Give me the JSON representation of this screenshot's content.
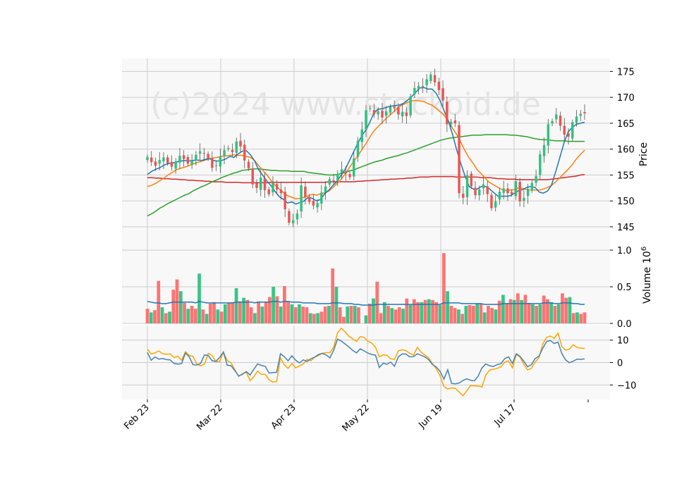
{
  "watermark": "(c)2024 www.stockoid.de",
  "chart_data": {
    "type": "candlestick",
    "title": "",
    "x_tick_labels": [
      "Feb 23",
      "Mar 22",
      "Apr 23",
      "May 22",
      "Jun 19",
      "Jul 17"
    ],
    "colors": {
      "up": "#26a69a",
      "up_fill": "#2ec27e",
      "down": "#ef5350",
      "ma_short": "#1f77b4",
      "ma_mid": "#ff7f0e",
      "ma_long": "#2ca02c",
      "ma_200": "#d62728",
      "vol_avg": "#1f77b4",
      "osc_1": "#4682b4",
      "osc_2": "#ffa500",
      "panel_bg": "#f8f8f8",
      "grid": "#cccccc"
    },
    "price_panel": {
      "ylabel": "Price",
      "ylim": [
        140.5,
        177.5
      ],
      "yticks": [
        145,
        150,
        155,
        160,
        165,
        170,
        175
      ],
      "closes": [
        158.5,
        157.5,
        156.8,
        157.9,
        158.4,
        157.3,
        156.6,
        157.5,
        158.7,
        158.1,
        157.2,
        157.8,
        158.9,
        159.6,
        159.2,
        158.2,
        156.4,
        156.9,
        158.6,
        159.8,
        160.2,
        159.4,
        161.5,
        160.5,
        157.8,
        156.3,
        153.2,
        152.5,
        154.5,
        152.1,
        151.3,
        153.5,
        152.2,
        151.5,
        148.4,
        145.8,
        146.3,
        147.6,
        153.0,
        150.8,
        149.8,
        149.1,
        149.6,
        151.6,
        152.8,
        154.2,
        153.9,
        155.2,
        156.1,
        155.3,
        154.6,
        158.2,
        161.6,
        163.8,
        167.5,
        167.9,
        166.8,
        167.3,
        166.1,
        167.3,
        168.2,
        167.9,
        166.7,
        167.2,
        166.4,
        170.2,
        171.8,
        172.2,
        172.1,
        173.5,
        174.4,
        172.9,
        171.4,
        169.4,
        164.8,
        165.3,
        165.0,
        151.5,
        150.6,
        154.9,
        152.8,
        151.1,
        152.2,
        153.2,
        151.3,
        148.6,
        149.9,
        151.8,
        152.4,
        151.5,
        151.3,
        153.8,
        149.9,
        150.6,
        152.3,
        153.5,
        154.8,
        159.0,
        160.8,
        164.8,
        165.4,
        166.7,
        164.5,
        162.8,
        162.4,
        165.2,
        166.3,
        166.8,
        166.9
      ],
      "ma_short": [
        155.1,
        155.7,
        156.1,
        156.4,
        156.9,
        157.2,
        157.3,
        157.5,
        157.7,
        157.8,
        157.7,
        157.8,
        157.9,
        157.8,
        158.0,
        158.2,
        157.8,
        157.7,
        157.8,
        158.1,
        158.6,
        158.4,
        159.1,
        159.6,
        159.7,
        158.9,
        157.7,
        156.0,
        154.9,
        153.8,
        152.9,
        151.8,
        150.8,
        150.3,
        149.6,
        149.8,
        149.4,
        149.7,
        150.0,
        150.7,
        150.5,
        150.0,
        150.3,
        151.4,
        152.1,
        153.0,
        153.8,
        155.0,
        156.2,
        157.8,
        159.5,
        161.1,
        162.6,
        163.7,
        165.3,
        167.1,
        167.7,
        167.8,
        168.1,
        168.3,
        168.4,
        168.5,
        168.8,
        169.4,
        170.1,
        170.9,
        171.8,
        171.9,
        171.6,
        171.6,
        170.8,
        169.3,
        167.3,
        165.4,
        162.8,
        159.8,
        157.2,
        154.8,
        152.8,
        152.3,
        152.3,
        152.8,
        152.8,
        152.3,
        151.6,
        150.9,
        150.9,
        150.9,
        151.0,
        151.5,
        152.0,
        152.2,
        152.6,
        152.8,
        152.6,
        151.7,
        151.5,
        151.9,
        153.1,
        155.7,
        158.4,
        161.2,
        163.3,
        164.2,
        164.8,
        165.0,
        165.2
      ],
      "ma_mid": [
        152.8,
        153.0,
        153.4,
        153.9,
        154.4,
        155.0,
        155.5,
        156.0,
        156.3,
        156.5,
        156.8,
        157.1,
        157.4,
        157.6,
        157.9,
        158.1,
        158.3,
        158.4,
        158.6,
        158.7,
        158.8,
        158.9,
        158.8,
        158.8,
        158.6,
        158.4,
        157.8,
        156.8,
        155.9,
        155.0,
        153.9,
        153.0,
        152.3,
        151.6,
        151.0,
        150.7,
        150.4,
        150.5,
        150.7,
        151.0,
        151.3,
        151.1,
        151.4,
        151.6,
        151.9,
        152.6,
        153.4,
        154.2,
        155.3,
        156.5,
        157.6,
        158.7,
        159.9,
        161.1,
        162.4,
        163.6,
        164.4,
        165.2,
        166.0,
        166.7,
        167.4,
        168.2,
        168.6,
        169.0,
        169.3,
        169.4,
        169.3,
        169.2,
        168.8,
        168.5,
        167.9,
        167.2,
        166.5,
        165.3,
        164.0,
        162.8,
        161.3,
        159.7,
        158.3,
        157.2,
        156.0,
        155.2,
        154.3,
        153.5,
        153.1,
        152.6,
        152.2,
        152.0,
        152.1,
        152.2,
        152.5,
        152.4,
        152.2,
        152.1,
        152.1,
        152.1,
        152.3,
        152.6,
        153.0,
        153.7,
        154.5,
        155.3,
        156.1,
        157.0,
        158.1,
        159.0,
        159.8
      ],
      "ma_long": [
        147.1,
        147.5,
        148.0,
        148.6,
        149.0,
        149.5,
        149.9,
        150.3,
        150.7,
        151.1,
        151.4,
        151.9,
        152.3,
        152.7,
        153.0,
        153.4,
        153.8,
        154.1,
        154.5,
        154.8,
        155.1,
        155.4,
        155.6,
        155.9,
        156.0,
        156.1,
        156.2,
        156.2,
        156.1,
        156.0,
        155.9,
        155.9,
        155.8,
        155.8,
        155.8,
        155.7,
        155.7,
        155.7,
        155.7,
        155.5,
        155.4,
        155.3,
        155.2,
        155.1,
        155.0,
        155.0,
        155.1,
        155.3,
        155.5,
        155.8,
        156.0,
        156.3,
        156.6,
        156.9,
        157.2,
        157.5,
        157.7,
        157.9,
        158.2,
        158.4,
        158.6,
        158.8,
        159.1,
        159.3,
        159.6,
        159.9,
        160.2,
        160.5,
        160.8,
        161.1,
        161.4,
        161.7,
        161.9,
        162.1,
        162.2,
        162.3,
        162.4,
        162.5,
        162.6,
        162.7,
        162.7,
        162.7,
        162.8,
        162.8,
        162.8,
        162.8,
        162.8,
        162.8,
        162.7,
        162.7,
        162.6,
        162.5,
        162.4,
        162.2,
        162.0,
        161.9,
        161.8,
        161.8,
        161.7,
        161.6,
        161.6,
        161.6,
        161.5,
        161.5,
        161.5,
        161.5,
        161.5
      ],
      "ma_200": [
        154.5,
        154.5,
        154.4,
        154.4,
        154.3,
        154.3,
        154.2,
        154.2,
        154.1,
        154.1,
        154.0,
        154.0,
        153.9,
        153.9,
        153.8,
        153.8,
        153.7,
        153.7,
        153.7,
        153.6,
        153.6,
        153.6,
        153.6,
        153.5,
        153.5,
        153.5,
        153.5,
        153.5,
        153.5,
        153.5,
        153.6,
        153.6,
        153.6,
        153.6,
        153.6,
        153.6,
        153.6,
        153.6,
        153.6,
        153.6,
        153.6,
        153.6,
        153.6,
        153.6,
        153.7,
        153.7,
        153.7,
        153.7,
        153.7,
        153.7,
        153.7,
        153.8,
        153.8,
        153.9,
        153.9,
        154.0,
        154.0,
        154.1,
        154.1,
        154.2,
        154.2,
        154.3,
        154.3,
        154.4,
        154.4,
        154.5,
        154.6,
        154.6,
        154.6,
        154.7,
        154.7,
        154.7,
        154.7,
        154.7,
        154.7,
        154.6,
        154.6,
        154.6,
        154.6,
        154.6,
        154.6,
        154.5,
        154.5,
        154.5,
        154.4,
        154.3,
        154.3,
        154.2,
        154.2,
        154.2,
        154.1,
        154.1,
        154.1,
        154.1,
        154.1,
        154.1,
        154.1,
        154.1,
        154.2,
        154.3,
        154.4,
        154.5,
        154.6,
        154.7,
        154.8,
        155.0,
        155.1
      ]
    },
    "volume_panel": {
      "ylabel": "Volume",
      "ylabel_multiplier": "10^6",
      "ylim": [
        0,
        1.0
      ],
      "yticks": [
        0.0,
        0.5,
        1.0
      ],
      "ytick_labels": [
        "0.0",
        "0.5",
        "1.0"
      ],
      "values": [
        0.2,
        0.15,
        0.18,
        0.58,
        0.22,
        0.14,
        0.16,
        0.46,
        0.6,
        0.44,
        0.28,
        0.2,
        0.24,
        0.2,
        0.68,
        0.19,
        0.13,
        0.27,
        0.29,
        0.19,
        0.16,
        0.26,
        0.28,
        0.29,
        0.48,
        0.3,
        0.35,
        0.32,
        0.22,
        0.14,
        0.3,
        0.23,
        0.29,
        0.36,
        0.5,
        0.37,
        0.23,
        0.51,
        0.3,
        0.26,
        0.22,
        0.26,
        0.23,
        0.22,
        0.14,
        0.13,
        0.14,
        0.16,
        0.23,
        0.24,
        0.75,
        0.5,
        0.22,
        0.09,
        0.23,
        0.24,
        0.24,
        0.22,
        0.0,
        0.11,
        0.27,
        0.34,
        0.57,
        0.14,
        0.29,
        0.24,
        0.21,
        0.19,
        0.22,
        0.2,
        0.34,
        0.25,
        0.33,
        0.29,
        0.29,
        0.32,
        0.33,
        0.32,
        0.29,
        0.25,
        0.96,
        0.44,
        0.24,
        0.21,
        0.19,
        0.13,
        0.24,
        0.25,
        0.24,
        0.27,
        0.27,
        0.15,
        0.24,
        0.21,
        0.19,
        0.31,
        0.39,
        0.27,
        0.33,
        0.32,
        0.41,
        0.32,
        0.39,
        0.28,
        0.26,
        0.24,
        0.26,
        0.38,
        0.33,
        0.29,
        0.24,
        0.26,
        0.41,
        0.35,
        0.36,
        0.14,
        0.15,
        0.13,
        0.15
      ],
      "avg": [
        0.3,
        0.29,
        0.28,
        0.28,
        0.27,
        0.27,
        0.28,
        0.29,
        0.29,
        0.29,
        0.29,
        0.29,
        0.29,
        0.28,
        0.3,
        0.29,
        0.28,
        0.28,
        0.28,
        0.28,
        0.28,
        0.28,
        0.28,
        0.28,
        0.29,
        0.29,
        0.29,
        0.29,
        0.29,
        0.28,
        0.29,
        0.29,
        0.29,
        0.29,
        0.3,
        0.3,
        0.29,
        0.3,
        0.3,
        0.29,
        0.29,
        0.29,
        0.28,
        0.28,
        0.28,
        0.28,
        0.27,
        0.27,
        0.27,
        0.27,
        0.28,
        0.28,
        0.28,
        0.27,
        0.27,
        0.27,
        0.26,
        0.26,
        0.25,
        0.25,
        0.25,
        0.25,
        0.26,
        0.26,
        0.26,
        0.26,
        0.26,
        0.26,
        0.26,
        0.26,
        0.26,
        0.26,
        0.26,
        0.26,
        0.26,
        0.26,
        0.26,
        0.26,
        0.26,
        0.26,
        0.28,
        0.28,
        0.28,
        0.28,
        0.28,
        0.27,
        0.27,
        0.27,
        0.27,
        0.27,
        0.27,
        0.26,
        0.26,
        0.26,
        0.26,
        0.26,
        0.27,
        0.27,
        0.27,
        0.27,
        0.27,
        0.27,
        0.27,
        0.27,
        0.27,
        0.27,
        0.27,
        0.28,
        0.28,
        0.28,
        0.27,
        0.27,
        0.28,
        0.28,
        0.28,
        0.27,
        0.27,
        0.26,
        0.26
      ]
    },
    "oscillator_panel": {
      "ylim": [
        -16.5,
        16.5
      ],
      "yticks": [
        -10,
        0,
        10
      ],
      "ytick_labels": [
        "−10",
        "0",
        "10"
      ],
      "line1": [
        4.5,
        1.0,
        2.5,
        1.5,
        1.8,
        1.3,
        1.2,
        -0.4,
        -0.7,
        -0.5,
        4.2,
        2.6,
        -1.0,
        -1.1,
        -0.4,
        3.4,
        3.1,
        0.8,
        0.5,
        2.2,
        4.7,
        -1.2,
        -1.4,
        -3.6,
        -6.0,
        -5.3,
        -4.0,
        -5.6,
        -3.0,
        -0.6,
        -1.3,
        -1.7,
        -4.7,
        -4.5,
        -4.4,
        3.9,
        2.6,
        0.8,
        3.0,
        1.0,
        -0.2,
        1.2,
        0.5,
        1.7,
        2.4,
        3.6,
        4.1,
        3.4,
        2.1,
        5.5,
        10.4,
        9.6,
        8.3,
        6.9,
        5.4,
        4.3,
        6.1,
        5.2,
        4.2,
        3.6,
        3.3,
        -2.2,
        -0.3,
        -0.8,
        0.2,
        -1.7,
        2.5,
        3.8,
        3.8,
        2.5,
        2.6,
        3.9,
        3.2,
        2.5,
        1.2,
        -0.9,
        -2.0,
        -4.0,
        -7.4,
        -3.2,
        -9.3,
        -9.5,
        -9.1,
        -8.0,
        -7.3,
        -7.9,
        -8.2,
        -6.1,
        -2.4,
        -0.7,
        -1.4,
        -1.8,
        -0.9,
        -0.5,
        1.8,
        2.5,
        -0.4,
        3.9,
        2.8,
        0.6,
        -1.9,
        -1.0,
        1.8,
        2.8,
        6.4,
        9.4,
        9.8,
        8.5,
        9.1,
        4.0,
        1.2,
        -0.1,
        0.6,
        1.5,
        1.4,
        1.6
      ],
      "line2": [
        6.0,
        3.8,
        4.3,
        5.2,
        3.9,
        3.7,
        3.9,
        2.2,
        2.8,
        1.0,
        4.8,
        3.2,
        2.7,
        -0.7,
        -1.5,
        -0.7,
        4.1,
        3.2,
        0.4,
        0.4,
        4.7,
        0.9,
        -0.1,
        -3.2,
        -6.2,
        -5.0,
        -4.3,
        -8.1,
        -6.3,
        -3.8,
        -5.3,
        -5.3,
        -7.7,
        -8.7,
        -8.5,
        2.1,
        -1.0,
        -2.6,
        -0.4,
        -2.4,
        -1.5,
        -0.6,
        1.4,
        0.8,
        2.4,
        3.1,
        4.1,
        4.4,
        4.4,
        6.9,
        13.2,
        15.3,
        13.7,
        11.8,
        10.6,
        9.4,
        11.6,
        11.2,
        9.4,
        8.7,
        6.8,
        2.5,
        3.4,
        3.2,
        1.6,
        1.4,
        5.2,
        5.7,
        5.3,
        4.1,
        3.3,
        6.8,
        4.6,
        3.3,
        2.0,
        -0.5,
        -2.9,
        -6.0,
        -10.7,
        -11.8,
        -11.3,
        -11.5,
        -13.2,
        -14.8,
        -12.6,
        -10.3,
        -10.4,
        -10.5,
        -10.9,
        -5.6,
        -3.4,
        -3.0,
        -2.6,
        -1.9,
        0.2,
        0.7,
        -2.4,
        3.5,
        2.5,
        -0.8,
        -3.3,
        -2.6,
        0.2,
        2.2,
        8.3,
        11.2,
        11.8,
        10.8,
        13.1,
        7.1,
        5.5,
        6.0,
        7.9,
        6.7,
        6.4,
        6.3
      ]
    }
  }
}
